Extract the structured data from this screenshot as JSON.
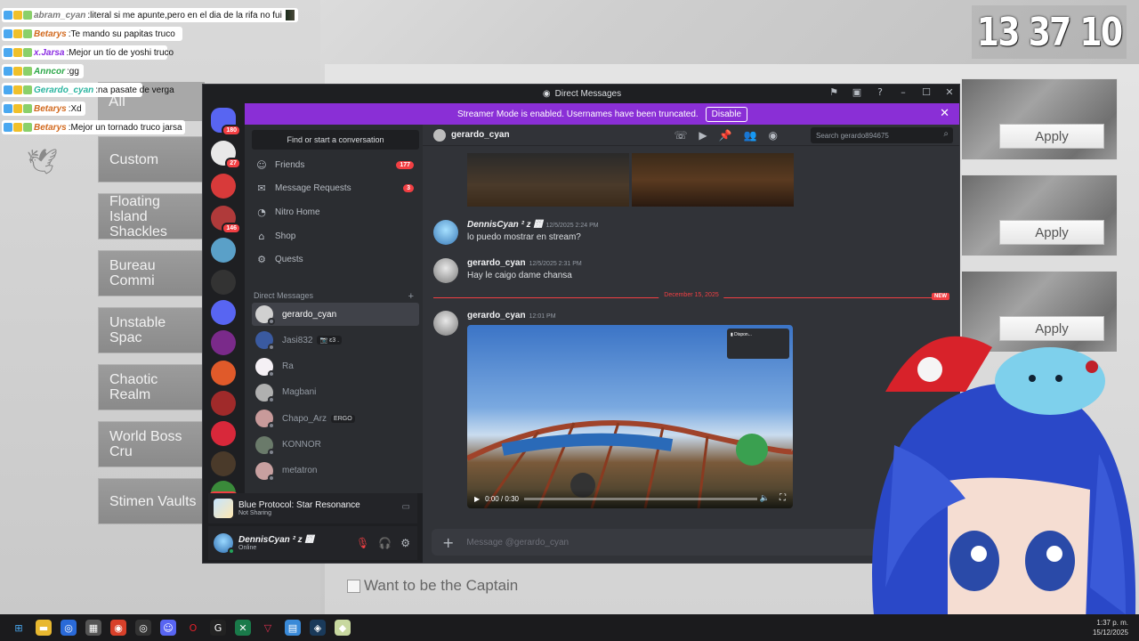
{
  "clock": {
    "time": "13 37 10"
  },
  "chat_overlay": [
    {
      "user": "abram_cyan",
      "message": "literal si me apunte,pero en el dia de la rifa no fui",
      "user_color": "#7a7a7a"
    },
    {
      "user": "Betarys",
      "message": "Te mando su papitas truco",
      "user_color": "#d2691e"
    },
    {
      "user": "x.Jarsa",
      "message": "Mejor un tío de yoshi truco",
      "user_color": "#8a2be2"
    },
    {
      "user": "Anncor",
      "message": "gg",
      "user_color": "#2ea84a"
    },
    {
      "user": "Gerardo_cyan",
      "message": "na pasate de verga",
      "user_color": "#2bb5a0"
    },
    {
      "user": "Betarys",
      "message": "Xd",
      "user_color": "#d2691e"
    },
    {
      "user": "Betarys",
      "message": "Mejor un tornado truco jarsa",
      "user_color": "#d2691e"
    }
  ],
  "game": {
    "categories": [
      "All",
      "Custom",
      "Floating Island Shackles",
      "Bureau Commi",
      "Unstable Spac",
      "Chaotic Realm",
      "World Boss Cru",
      "Stimen Vaults"
    ],
    "apply_label": "Apply",
    "captain_label": "Want to be the Captain"
  },
  "discord": {
    "window_title": "Direct Messages",
    "banner": {
      "text": "Streamer Mode is enabled. Usernames have been truncated.",
      "button": "Disable"
    },
    "servers": [
      {
        "badge": "180",
        "color": "#5865f2"
      },
      {
        "badge": "27",
        "color": "#e8e8e8"
      },
      {
        "badge": "",
        "color": "#d83a3a"
      },
      {
        "badge": "146",
        "color": "#b03a3a"
      },
      {
        "badge": "",
        "color": "#5aa0c8"
      },
      {
        "badge": "",
        "color": "#333333"
      },
      {
        "badge": "",
        "color": "#5865f2"
      },
      {
        "badge": "",
        "color": "#7a2a8a"
      },
      {
        "badge": "",
        "color": "#e05a2a"
      },
      {
        "badge": "",
        "color": "#a02a2a"
      },
      {
        "badge": "",
        "color": "#d8283a"
      },
      {
        "badge": "",
        "color": "#4a3a2a"
      },
      {
        "badge": "",
        "color": "#3a8a3a"
      }
    ],
    "new_label": "NEW",
    "search_placeholder": "Find or start a conversation",
    "nav": [
      {
        "label": "Friends",
        "count": "177",
        "icon": "friends-icon"
      },
      {
        "label": "Message Requests",
        "count": "3",
        "icon": "mail-icon"
      },
      {
        "label": "Nitro Home",
        "count": "",
        "icon": "nitro-icon"
      },
      {
        "label": "Shop",
        "count": "",
        "icon": "shop-icon"
      },
      {
        "label": "Quests",
        "count": "",
        "icon": "quests-icon"
      }
    ],
    "dm_header": "Direct Messages",
    "dms": [
      {
        "name": "gerardo_cyan",
        "tag": "",
        "color": "#d0d0d0"
      },
      {
        "name": "Jasi832",
        "tag": "📷 ε3 .",
        "color": "#3a5aa0"
      },
      {
        "name": "Ra",
        "tag": "",
        "color": "#f5f0f5"
      },
      {
        "name": "Magbani",
        "tag": "",
        "color": "#b0b0b0"
      },
      {
        "name": "Chapo_Arz",
        "tag": "ERGO",
        "color": "#c89a9a"
      },
      {
        "name": "KONNOR",
        "tag": "",
        "color": "#6a7a6a"
      },
      {
        "name": "metatron",
        "tag": "",
        "color": "#c8a0a0"
      }
    ],
    "activity": {
      "title": "Blue Protocol: Star Resonance",
      "subtitle": "Not Sharing"
    },
    "user": {
      "name": "DennisCyan ² z ⹸",
      "status": "Online"
    },
    "chat": {
      "recipient": "gerardo_cyan",
      "search_placeholder": "Search gerardo894675",
      "messages": [
        {
          "author": "DennisCyan ² z ⹸",
          "time": "12/5/2025 2:24 PM",
          "text": "lo puedo mostrar en stream?",
          "color": "#8ad0f0"
        },
        {
          "author": "gerardo_cyan",
          "time": "12/5/2025 2:31 PM",
          "text": "Hay le caigo dame chansa",
          "color": "#c8c8c8"
        }
      ],
      "divider_date": "December 15, 2025",
      "new_label": "NEW",
      "video_message": {
        "author": "gerardo_cyan",
        "time": "12:01 PM",
        "duration": "0:00 / 0:30"
      },
      "composer_placeholder": "Message @gerardo_cyan"
    }
  },
  "taskbar": {
    "time": "1:37 p. m.",
    "date": "15/12/2025"
  }
}
